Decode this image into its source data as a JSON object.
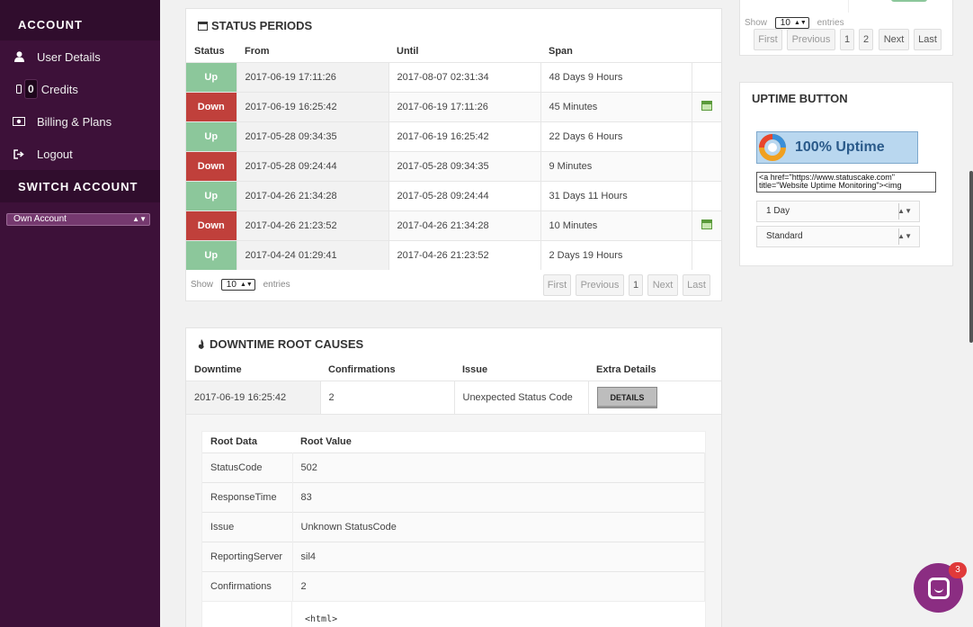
{
  "sidebar": {
    "account_heading": "ACCOUNT",
    "items": [
      {
        "label": "User Details",
        "icon": "user-icon"
      },
      {
        "label": "Credits",
        "icon": "mobile-icon",
        "badge": "0"
      },
      {
        "label": "Billing & Plans",
        "icon": "money-icon"
      },
      {
        "label": "Logout",
        "icon": "logout-icon"
      }
    ],
    "switch_heading": "SWITCH ACCOUNT",
    "account_select": "Own Account"
  },
  "status_periods": {
    "title": "STATUS PERIODS",
    "columns": [
      "Status",
      "From",
      "Until",
      "Span"
    ],
    "rows": [
      {
        "status": "Up",
        "from": "2017-06-19 17:11:26",
        "until": "2017-08-07 02:31:34",
        "span": "48 Days 9 Hours",
        "icon": false
      },
      {
        "status": "Down",
        "from": "2017-06-19 16:25:42",
        "until": "2017-06-19 17:11:26",
        "span": "45 Minutes",
        "icon": true
      },
      {
        "status": "Up",
        "from": "2017-05-28 09:34:35",
        "until": "2017-06-19 16:25:42",
        "span": "22 Days 6 Hours",
        "icon": false
      },
      {
        "status": "Down",
        "from": "2017-05-28 09:24:44",
        "until": "2017-05-28 09:34:35",
        "span": "9 Minutes",
        "icon": false
      },
      {
        "status": "Up",
        "from": "2017-04-26 21:34:28",
        "until": "2017-05-28 09:24:44",
        "span": "31 Days 11 Hours",
        "icon": false
      },
      {
        "status": "Down",
        "from": "2017-04-26 21:23:52",
        "until": "2017-04-26 21:34:28",
        "span": "10 Minutes",
        "icon": true
      },
      {
        "status": "Up",
        "from": "2017-04-24 01:29:41",
        "until": "2017-04-26 21:23:52",
        "span": "2 Days 19 Hours",
        "icon": false
      }
    ],
    "show_label": "Show",
    "show_value": "10",
    "entries_label": "entries",
    "pager": {
      "first": "First",
      "previous": "Previous",
      "page": "1",
      "next": "Next",
      "last": "Last"
    }
  },
  "downtime": {
    "title": "DOWNTIME ROOT CAUSES",
    "columns": [
      "Downtime",
      "Confirmations",
      "Issue",
      "Extra Details"
    ],
    "row": {
      "downtime": "2017-06-19 16:25:42",
      "confirmations": "2",
      "issue": "Unexpected Status Code",
      "button": "DETAILS"
    },
    "inner_columns": [
      "Root Data",
      "Root Value"
    ],
    "inner_rows": [
      {
        "key": "StatusCode",
        "value": "502"
      },
      {
        "key": "ResponseTime",
        "value": "83"
      },
      {
        "key": "Issue",
        "value": "Unknown StatusCode"
      },
      {
        "key": "ReportingServer",
        "value": "sil4"
      },
      {
        "key": "Confirmations",
        "value": "2"
      }
    ],
    "html_snippet": "<html>"
  },
  "top_right_pager": {
    "show_label": "Show",
    "show_value": "10",
    "entries_label": "entries",
    "buttons": {
      "first": "First",
      "previous": "Previous",
      "p1": "1",
      "p2": "2",
      "next": "Next",
      "last": "Last"
    }
  },
  "uptime_button": {
    "title": "UPTIME BUTTON",
    "badge_text": "100% Uptime",
    "embed_code": "<a href=\"https://www.statuscake.com\" title=\"Website Uptime Monitoring\"><img",
    "period_select": "1 Day",
    "style_select": "Standard"
  },
  "chat": {
    "badge": "3"
  }
}
